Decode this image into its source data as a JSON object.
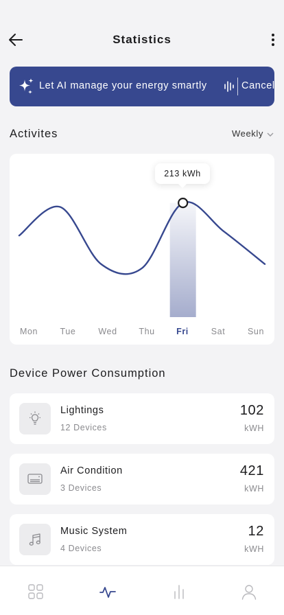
{
  "header": {
    "title": "Statistics",
    "back_icon": "arrow-left-icon",
    "more_icon": "more-vertical-icon"
  },
  "ai_banner": {
    "text": "Let AI manage your energy smartly",
    "cancel_label": "Cancel",
    "icon": "sparkles-icon",
    "voice_icon": "voice-wave-icon",
    "background": "#37488f"
  },
  "activities": {
    "title": "Activites",
    "period": "Weekly"
  },
  "chart_data": {
    "type": "line",
    "categories": [
      "Mon",
      "Tue",
      "Wed",
      "Thu",
      "Fri",
      "Sat",
      "Sun"
    ],
    "series": [
      {
        "values": [
          205,
          212,
          198,
          197,
          213,
          206,
          198
        ],
        "color": "#37488f"
      }
    ],
    "highlight": {
      "category": "Fri",
      "label": "213 kWh"
    },
    "ylim": [
      185,
      220
    ],
    "grid": false,
    "title": "",
    "xlabel": "",
    "ylabel": ""
  },
  "devices": {
    "title": "Device Power Consumption",
    "items": [
      {
        "name": "Lightings",
        "count": "12 Devices",
        "value": "102",
        "unit": "kWH",
        "icon": "lightbulb-icon"
      },
      {
        "name": "Air Condition",
        "count": "3 Devices",
        "value": "421",
        "unit": "kWH",
        "icon": "air-conditioner-icon"
      },
      {
        "name": "Music System",
        "count": "4 Devices",
        "value": "12",
        "unit": "kWH",
        "icon": "music-note-icon"
      }
    ]
  },
  "bottom_nav": {
    "items": [
      {
        "icon": "grid-icon",
        "active": false
      },
      {
        "icon": "activity-icon",
        "active": true
      },
      {
        "icon": "bar-chart-icon",
        "active": false
      },
      {
        "icon": "user-icon",
        "active": false
      }
    ],
    "active_color": "#37488f",
    "inactive_color": "#b9b9bd"
  }
}
